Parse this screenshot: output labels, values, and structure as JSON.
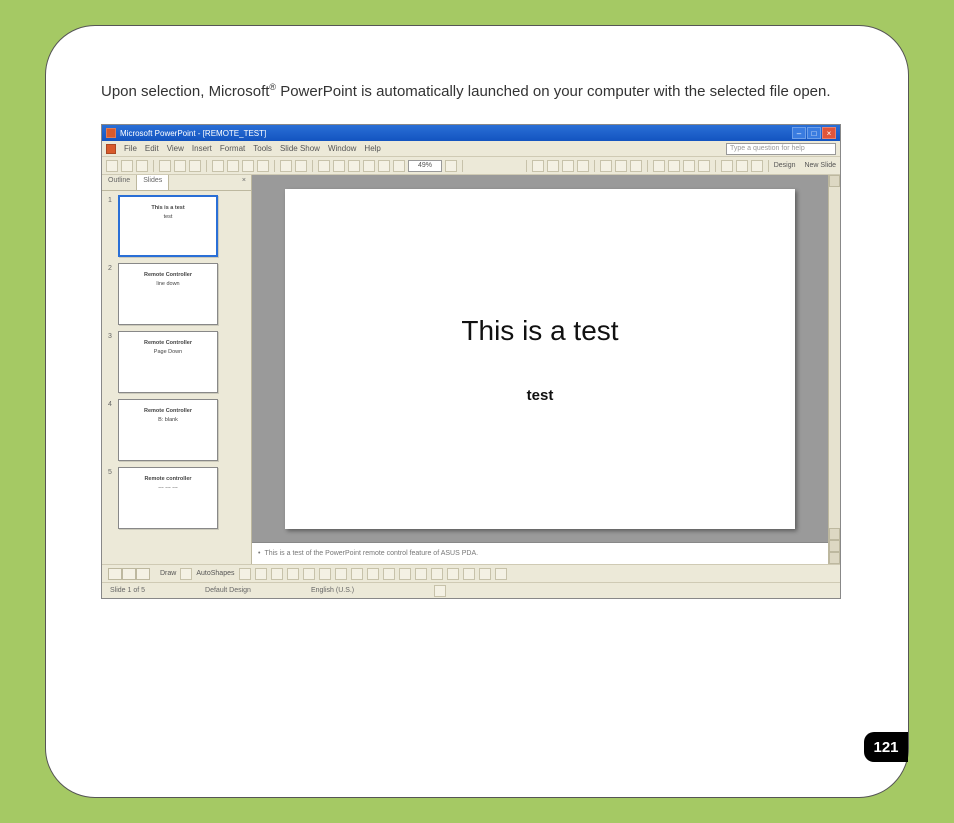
{
  "doc": {
    "intro_before": "Upon selection, Microsoft",
    "reg": "®",
    "intro_after": " PowerPoint is automatically launched on your computer with the selected file open.",
    "page_number": "121"
  },
  "ppt": {
    "titlebar": "Microsoft PowerPoint - [REMOTE_TEST]",
    "question_hint": "Type a question for help",
    "menus": [
      "File",
      "Edit",
      "View",
      "Insert",
      "Format",
      "Tools",
      "Slide Show",
      "Window",
      "Help"
    ],
    "zoom": "49%",
    "panel": {
      "tab_outline": "Outline",
      "tab_slides": "Slides",
      "close": "×"
    },
    "thumbs": [
      {
        "n": "1",
        "t1": "This is a test",
        "t2": "test"
      },
      {
        "n": "2",
        "t1": "Remote Controller",
        "t2": "line down"
      },
      {
        "n": "3",
        "t1": "Remote Controller",
        "t2": "Page Down"
      },
      {
        "n": "4",
        "t1": "Remote Controller",
        "t2": "B: blank"
      },
      {
        "n": "5",
        "t1": "Remote controller",
        "t2": "--- --- ---"
      }
    ],
    "slide": {
      "title": "This is a test",
      "sub": "test"
    },
    "notes": "This is a test of the PowerPoint remote control feature of ASUS PDA.",
    "draw_label": "Draw",
    "autoshapes": "AutoShapes",
    "status": {
      "slide": "Slide 1 of 5",
      "design": "Default Design",
      "lang": "English (U.S.)"
    },
    "right_links": {
      "design": "Design",
      "new_slide": "New Slide"
    }
  }
}
